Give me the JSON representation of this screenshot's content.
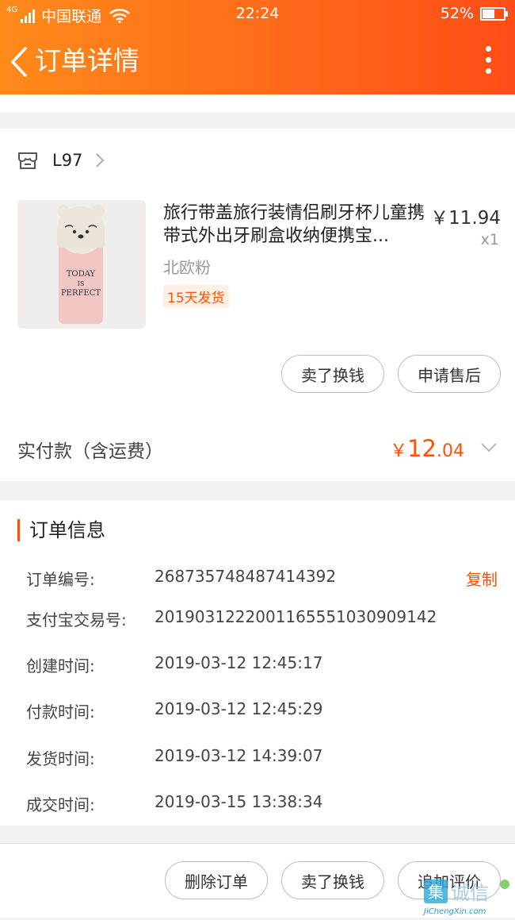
{
  "status_bar": {
    "network": "4G",
    "carrier": "中国联通",
    "time": "22:24",
    "battery": "52%",
    "battery_level": 0.52
  },
  "nav": {
    "title": "订单详情"
  },
  "store": {
    "name": "L97"
  },
  "product": {
    "title": "旅行带盖旅行装情侣刷牙杯儿童携带式外出牙刷盒收纳便携宝...",
    "price": "￥11.94",
    "quantity": "x1",
    "variant": "北欧粉",
    "shipping_tag": "15天发货",
    "image_text": [
      "TODAY",
      "IS",
      "PERFECT"
    ]
  },
  "item_actions": {
    "sell": "卖了换钱",
    "after_sale": "申请售后"
  },
  "payment": {
    "label": "实付款（含运费）",
    "currency": "￥",
    "amount_int": "12",
    "amount_dec": ".04"
  },
  "order_info": {
    "title": "订单信息",
    "copy_label": "复制",
    "rows": [
      {
        "label": "订单编号:",
        "value": "268735748487414392"
      },
      {
        "label": "支付宝交易号:",
        "value": "20190312220011655510309091​42"
      },
      {
        "label": "创建时间:",
        "value": "2019-03-12 12:45:17"
      },
      {
        "label": "付款时间:",
        "value": "2019-03-12 12:45:29"
      },
      {
        "label": "发货时间:",
        "value": "2019-03-12 14:39:07"
      },
      {
        "label": "成交时间:",
        "value": "2019-03-15 13:38:34"
      }
    ]
  },
  "bottom_actions": {
    "delete": "删除订单",
    "sell": "卖了换钱",
    "review": "追加评价"
  },
  "watermark": {
    "glyph": "集",
    "text": "诚信",
    "url": "JiChengXin.com"
  },
  "colors": {
    "accent": "#ff5000",
    "header_start": "#ff8a1a",
    "header_end": "#ff4d17"
  }
}
